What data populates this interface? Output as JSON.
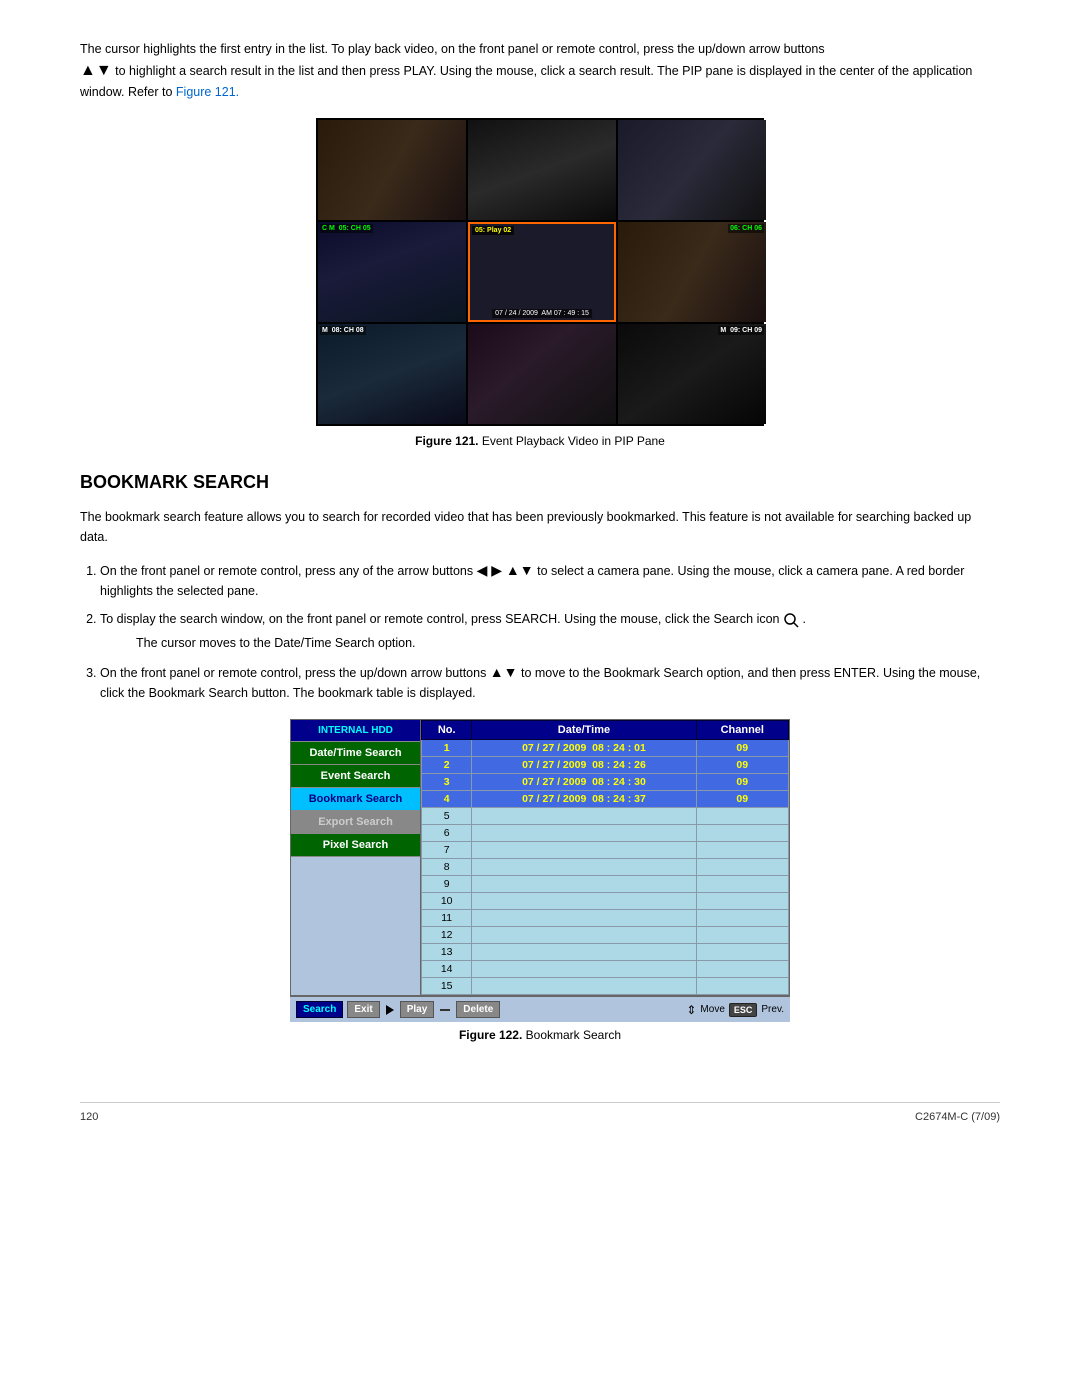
{
  "page": {
    "number": "120",
    "doc_id": "C2674M-C (7/09)"
  },
  "intro": {
    "text": "The cursor highlights the first entry in the list. To play back video, on the front panel or remote control, press the up/down arrow buttons",
    "text2": "to highlight a search result in the list and then press PLAY. Using the mouse, click a search result. The PIP pane is displayed in the center of the application window. Refer to",
    "link": "Figure 121.",
    "text3": "."
  },
  "figure121": {
    "caption_prefix": "Figure 121.",
    "caption_text": "Event Playback Video in PIP Pane"
  },
  "figure122": {
    "caption_prefix": "Figure 122.",
    "caption_text": "Bookmark Search"
  },
  "section": {
    "heading": "BOOKMARK SEARCH",
    "description": "The bookmark search feature allows you to search for recorded video that has been previously bookmarked. This feature is not available for searching backed up data.",
    "steps": [
      {
        "id": 1,
        "text": "On the front panel or remote control, press any of the arrow buttons",
        "text2": "to select a camera pane. Using the mouse, click a camera pane. A red border highlights the selected pane."
      },
      {
        "id": 2,
        "text": "To display the search window, on the front panel or remote control, press SEARCH. Using the mouse, click the Search icon",
        "text2": ".",
        "note": "The cursor moves to the Date/Time Search option."
      },
      {
        "id": 3,
        "text": "On the front panel or remote control, press the up/down arrow buttons",
        "text2": "to move to the Bookmark Search option, and then press ENTER. Using the mouse, click the Bookmark Search button. The bookmark table is displayed."
      }
    ]
  },
  "ui": {
    "sidebar": {
      "buttons": [
        {
          "id": "internal-hdd",
          "label": "INTERNAL HDD",
          "style": "internal"
        },
        {
          "id": "datetime-search",
          "label": "Date/Time Search",
          "style": "active-green"
        },
        {
          "id": "event-search",
          "label": "Event Search",
          "style": "active-green"
        },
        {
          "id": "bookmark-search",
          "label": "Bookmark Search",
          "style": "selected-blue"
        },
        {
          "id": "export-search",
          "label": "Export Search",
          "style": "disabled"
        },
        {
          "id": "pixel-search",
          "label": "Pixel Search",
          "style": "active-green"
        }
      ]
    },
    "table": {
      "headers": [
        "No.",
        "Date/Time",
        "Channel"
      ],
      "rows": [
        {
          "no": "1",
          "datetime": "07 / 27 / 2009  08 : 24 : 01",
          "channel": "09",
          "highlighted": true
        },
        {
          "no": "2",
          "datetime": "07 / 27 / 2009  08 : 24 : 26",
          "channel": "09",
          "highlighted": true
        },
        {
          "no": "3",
          "datetime": "07 / 27 / 2009  08 : 24 : 30",
          "channel": "09",
          "highlighted": true
        },
        {
          "no": "4",
          "datetime": "07 / 27 / 2009  08 : 24 : 37",
          "channel": "09",
          "highlighted": true
        },
        {
          "no": "5",
          "datetime": "",
          "channel": "",
          "highlighted": false
        },
        {
          "no": "6",
          "datetime": "",
          "channel": "",
          "highlighted": false
        },
        {
          "no": "7",
          "datetime": "",
          "channel": "",
          "highlighted": false
        },
        {
          "no": "8",
          "datetime": "",
          "channel": "",
          "highlighted": false
        },
        {
          "no": "9",
          "datetime": "",
          "channel": "",
          "highlighted": false
        },
        {
          "no": "10",
          "datetime": "",
          "channel": "",
          "highlighted": false
        },
        {
          "no": "11",
          "datetime": "",
          "channel": "",
          "highlighted": false
        },
        {
          "no": "12",
          "datetime": "",
          "channel": "",
          "highlighted": false
        },
        {
          "no": "13",
          "datetime": "",
          "channel": "",
          "highlighted": false
        },
        {
          "no": "14",
          "datetime": "",
          "channel": "",
          "highlighted": false
        },
        {
          "no": "15",
          "datetime": "",
          "channel": "",
          "highlighted": false
        }
      ]
    },
    "toolbar": {
      "search_label": "Search",
      "exit_label": "Exit",
      "play_label": "Play",
      "delete_label": "Delete",
      "move_label": "Move",
      "esc_label": "ESC",
      "prev_label": "Prev."
    }
  },
  "cameras": [
    {
      "id": 1,
      "label": "",
      "row": 1,
      "col": 1
    },
    {
      "id": 2,
      "label": "",
      "row": 1,
      "col": 2
    },
    {
      "id": 3,
      "label": "",
      "row": 1,
      "col": 3
    },
    {
      "id": 4,
      "label": "C M  05: CH 05",
      "row": 2,
      "col": 1
    },
    {
      "id": 5,
      "label": "05: Play 02",
      "row": 2,
      "col": 2,
      "active": true,
      "timestamp": "07 / 24 / 2009  AM 07 : 49 : 15"
    },
    {
      "id": 6,
      "label": "06: CH 06",
      "row": 2,
      "col": 3
    },
    {
      "id": 7,
      "label": "M  08: CH 08",
      "row": 3,
      "col": 1
    },
    {
      "id": 8,
      "label": "",
      "row": 3,
      "col": 2
    },
    {
      "id": 9,
      "label": "M  09: CH 09",
      "row": 3,
      "col": 3
    }
  ]
}
